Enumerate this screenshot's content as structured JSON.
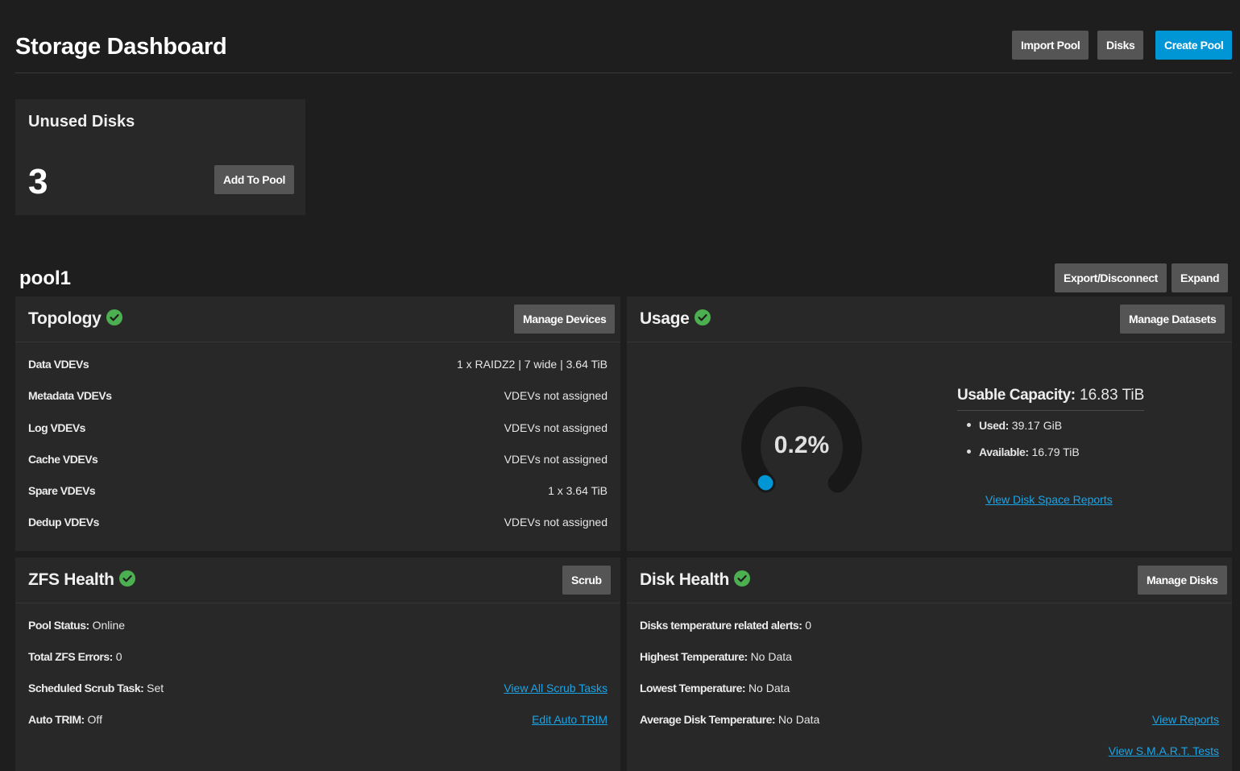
{
  "header": {
    "title": "Storage Dashboard",
    "import_pool": "Import Pool",
    "disks": "Disks",
    "create_pool": "Create Pool"
  },
  "unused_disks": {
    "title": "Unused Disks",
    "count": "3",
    "add_to_pool": "Add To Pool"
  },
  "pool": {
    "name": "pool1",
    "export_disconnect": "Export/Disconnect",
    "expand": "Expand"
  },
  "topology": {
    "title": "Topology",
    "manage_devices": "Manage Devices",
    "rows": [
      {
        "label": "Data VDEVs",
        "value": "1 x RAIDZ2 | 7 wide | 3.64 TiB"
      },
      {
        "label": "Metadata VDEVs",
        "value": "VDEVs not assigned"
      },
      {
        "label": "Log VDEVs",
        "value": "VDEVs not assigned"
      },
      {
        "label": "Cache VDEVs",
        "value": "VDEVs not assigned"
      },
      {
        "label": "Spare VDEVs",
        "value": "1 x 3.64 TiB"
      },
      {
        "label": "Dedup VDEVs",
        "value": "VDEVs not assigned"
      }
    ]
  },
  "usage": {
    "title": "Usage",
    "manage_datasets": "Manage Datasets",
    "gauge_percent": 0.2,
    "gauge_label": "0.2%",
    "usable_label": "Usable Capacity:",
    "usable_value": "16.83 TiB",
    "used_label": "Used:",
    "used_value": "39.17 GiB",
    "available_label": "Available:",
    "available_value": "16.79 TiB",
    "reports_link": "View Disk Space Reports",
    "accent_color": "#0095d5"
  },
  "zfs_health": {
    "title": "ZFS Health",
    "scrub": "Scrub",
    "pool_status_label": "Pool Status:",
    "pool_status_value": "Online",
    "errors_label": "Total ZFS Errors:",
    "errors_value": "0",
    "scrub_task_label": "Scheduled Scrub Task:",
    "scrub_task_value": "Set",
    "scrub_link": "View All Scrub Tasks",
    "trim_label": "Auto TRIM:",
    "trim_value": "Off",
    "trim_link": "Edit Auto TRIM"
  },
  "disk_health": {
    "title": "Disk Health",
    "manage_disks": "Manage Disks",
    "alerts_label": "Disks temperature related alerts:",
    "alerts_value": "0",
    "highest_label": "Highest Temperature:",
    "highest_value": "No Data",
    "lowest_label": "Lowest Temperature:",
    "lowest_value": "No Data",
    "average_label": "Average Disk Temperature:",
    "average_value": "No Data",
    "reports_link": "View Reports",
    "smart_link": "View S.M.A.R.T. Tests"
  },
  "colors": {
    "status_ok": "#4caf50",
    "primary": "#0095d5",
    "link": "#1aa5e8"
  }
}
